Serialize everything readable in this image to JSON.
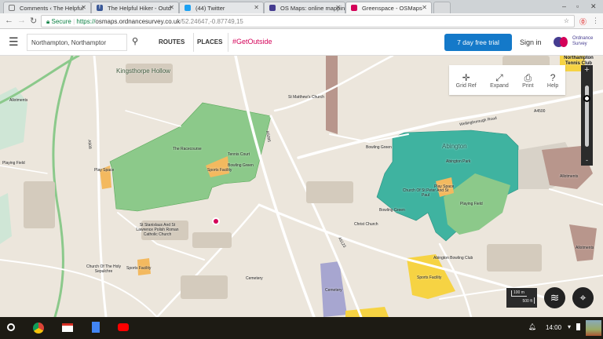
{
  "tabs": [
    {
      "title": "Comments ‹ The Helpful",
      "favicon": "page-icon",
      "active": false
    },
    {
      "title": "The Helpful Hiker - Outd",
      "favicon": "facebook-icon",
      "active": false
    },
    {
      "title": "(44) Twitter",
      "favicon": "twitter-icon",
      "active": false
    },
    {
      "title": "OS Maps: online mappin",
      "favicon": "os-icon",
      "active": false
    },
    {
      "title": "Greenspace - OSMaps",
      "favicon": "os-icon",
      "active": true
    }
  ],
  "address": {
    "secure_label": "Secure",
    "scheme": "https://",
    "host": "osmaps.ordnancesurvey.co.uk",
    "path": "/52.24647,-0.87749,15"
  },
  "header": {
    "search_value": "Northampton, Northamptor",
    "nav": [
      "ROUTES",
      "PLACES"
    ],
    "hashtag": "#GetOutside",
    "trial_label": "7 day free trial",
    "signin_label": "Sign in",
    "logo_text": "Ordnance Survey"
  },
  "tools": [
    {
      "label": "Grid Ref",
      "icon": "crosshair-icon"
    },
    {
      "label": "Expand",
      "icon": "expand-icon"
    },
    {
      "label": "Print",
      "icon": "print-icon"
    },
    {
      "label": "Help",
      "icon": "help-icon"
    }
  ],
  "zoom": {
    "plus": "+",
    "minus": "-",
    "level": 0.2
  },
  "scale": {
    "metric": "100 m",
    "imperial": "500 ft"
  },
  "map_labels": {
    "kingsthorpe": "Kingsthorpe Hollow",
    "allot1": "Allotments",
    "playingfield1": "Playing Field",
    "racecourse": "The Racecourse",
    "tennis": "Tennis Court",
    "bowling1": "Bowling Green",
    "sports1": "Sports Facility",
    "playspace1": "Play Space",
    "stmatthew": "St Matthew's Church",
    "bowling2": "Bowling Green",
    "abington": "Abington",
    "abingtonpark": "Abington Park",
    "stpeter": "Church Of St Peter And St Paul",
    "playspace2": "Play Space",
    "playingfield2": "Playing Field",
    "bowling3": "Bowling Green",
    "christ": "Christ Church",
    "allot2": "Allotments",
    "allot3": "Allotments",
    "ststan": "St Stanislaus And St Lawrence Polish Roman Catholic Church",
    "holysep": "Church Of The Holy Sepulchre",
    "sports2": "Sports Facility",
    "cem1": "Cemetery",
    "cem2": "Cemetery",
    "abbowl": "Abington Bowling Club",
    "sports3": "Sports Facility",
    "nthtennis": "Northampton Tennis Club",
    "wellroad": "Wellingborough Road",
    "a4500": "A4500",
    "a5095": "A5095",
    "a508": "A508",
    "a5123": "A5123"
  },
  "status": {
    "time": "14:00"
  }
}
